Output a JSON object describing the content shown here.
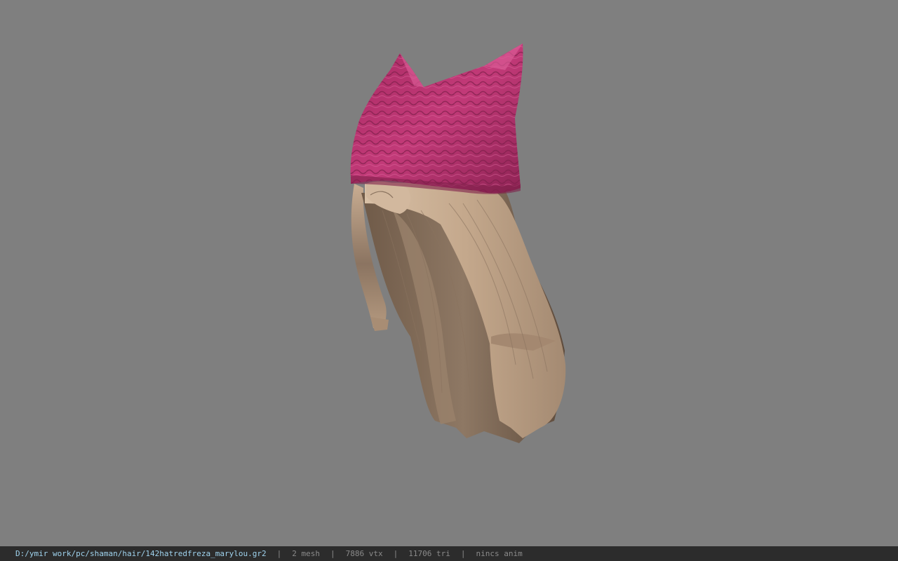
{
  "viewport": {
    "background_color": "#7f7f7f",
    "model": {
      "hat_color": "#c23a78",
      "hat_shadow_color": "#7e1f4a",
      "hair_color": "#c9ad92",
      "hair_shadow_color": "#6f5a48"
    }
  },
  "statusbar": {
    "file_path": "D:/ymir work/pc/shaman/hair/142hatredfreza_marylou.gr2",
    "separator": "|",
    "mesh_count": "2 mesh",
    "vertex_count": "7886 vtx",
    "triangle_count": "11706 tri",
    "animation": "nincs anim"
  }
}
